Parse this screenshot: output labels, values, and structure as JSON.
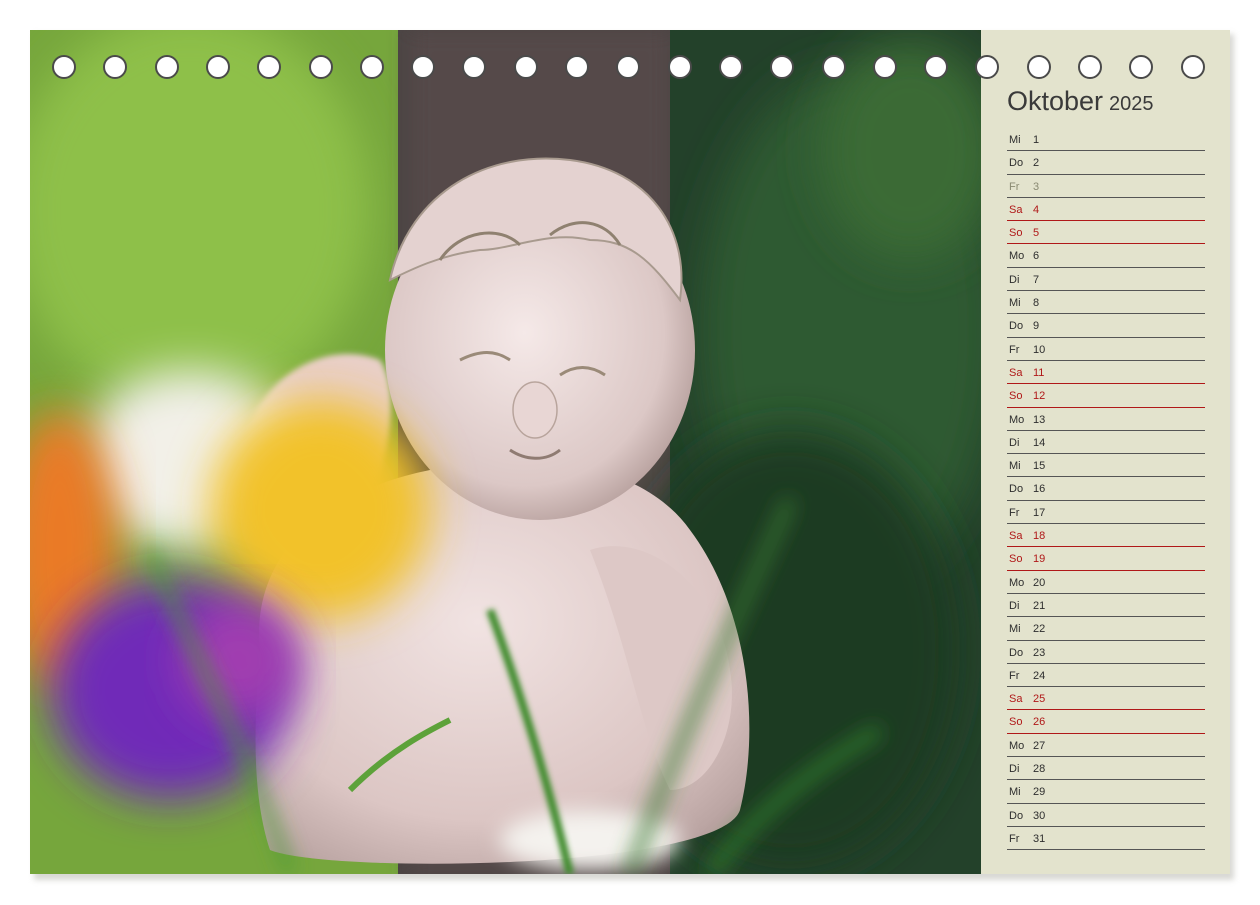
{
  "calendar": {
    "month": "Oktober",
    "year": "2025",
    "days": [
      {
        "weekday": "Mi",
        "day": "1",
        "type": "normal"
      },
      {
        "weekday": "Do",
        "day": "2",
        "type": "normal"
      },
      {
        "weekday": "Fr",
        "day": "3",
        "type": "holiday"
      },
      {
        "weekday": "Sa",
        "day": "4",
        "type": "weekend"
      },
      {
        "weekday": "So",
        "day": "5",
        "type": "weekend"
      },
      {
        "weekday": "Mo",
        "day": "6",
        "type": "normal"
      },
      {
        "weekday": "Di",
        "day": "7",
        "type": "normal"
      },
      {
        "weekday": "Mi",
        "day": "8",
        "type": "normal"
      },
      {
        "weekday": "Do",
        "day": "9",
        "type": "normal"
      },
      {
        "weekday": "Fr",
        "day": "10",
        "type": "normal"
      },
      {
        "weekday": "Sa",
        "day": "11",
        "type": "weekend"
      },
      {
        "weekday": "So",
        "day": "12",
        "type": "weekend"
      },
      {
        "weekday": "Mo",
        "day": "13",
        "type": "normal"
      },
      {
        "weekday": "Di",
        "day": "14",
        "type": "normal"
      },
      {
        "weekday": "Mi",
        "day": "15",
        "type": "normal"
      },
      {
        "weekday": "Do",
        "day": "16",
        "type": "normal"
      },
      {
        "weekday": "Fr",
        "day": "17",
        "type": "normal"
      },
      {
        "weekday": "Sa",
        "day": "18",
        "type": "weekend"
      },
      {
        "weekday": "So",
        "day": "19",
        "type": "weekend"
      },
      {
        "weekday": "Mo",
        "day": "20",
        "type": "normal"
      },
      {
        "weekday": "Di",
        "day": "21",
        "type": "normal"
      },
      {
        "weekday": "Mi",
        "day": "22",
        "type": "normal"
      },
      {
        "weekday": "Do",
        "day": "23",
        "type": "normal"
      },
      {
        "weekday": "Fr",
        "day": "24",
        "type": "normal"
      },
      {
        "weekday": "Sa",
        "day": "25",
        "type": "weekend"
      },
      {
        "weekday": "So",
        "day": "26",
        "type": "weekend"
      },
      {
        "weekday": "Mo",
        "day": "27",
        "type": "normal"
      },
      {
        "weekday": "Di",
        "day": "28",
        "type": "normal"
      },
      {
        "weekday": "Mi",
        "day": "29",
        "type": "normal"
      },
      {
        "weekday": "Do",
        "day": "30",
        "type": "normal"
      },
      {
        "weekday": "Fr",
        "day": "31",
        "type": "normal"
      }
    ],
    "binding_hole_count": 23
  },
  "colors": {
    "panel_background": "#e3e3cd",
    "weekend": "#b01818",
    "holiday": "#8a8a72",
    "text": "#2e2e2e"
  }
}
